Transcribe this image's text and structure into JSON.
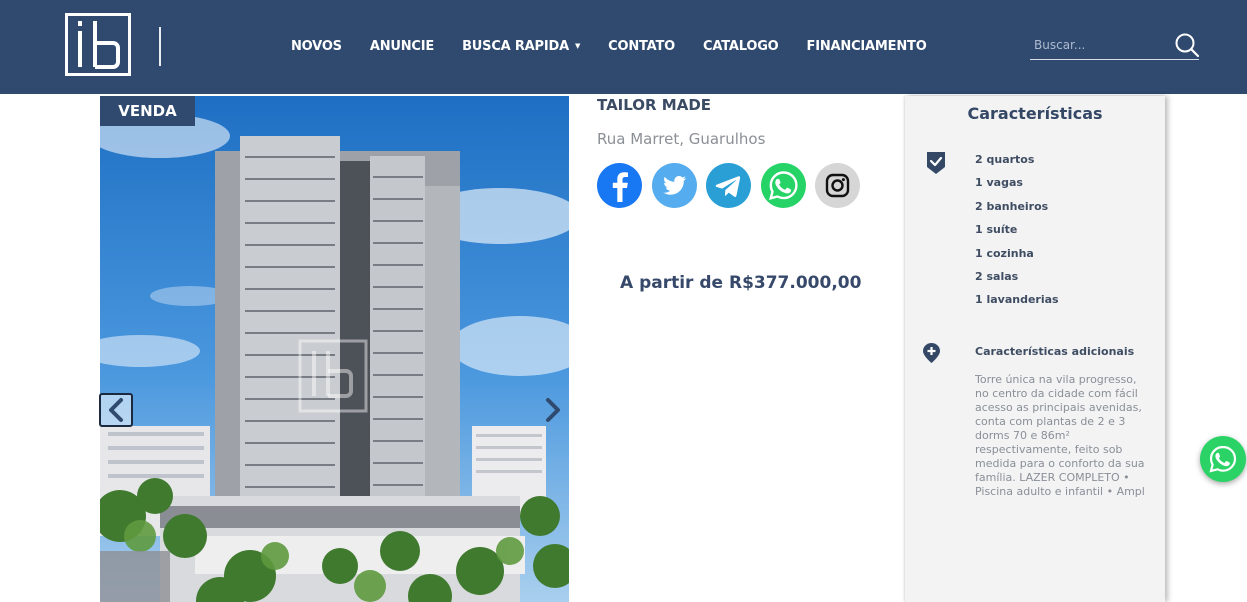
{
  "header": {
    "logo_text": "ib",
    "nav": [
      {
        "label": "NOVOS"
      },
      {
        "label": "ANUNCIE"
      },
      {
        "label": "BUSCA RAPIDA",
        "has_caret": true
      },
      {
        "label": "CONTATO"
      },
      {
        "label": "CATALOGO"
      },
      {
        "label": "FINANCIAMENTO"
      }
    ],
    "search_placeholder": "Buscar...",
    "search_icon": "search-icon"
  },
  "listing": {
    "badge": "VENDA",
    "title": "TAILOR MADE",
    "address": "Rua Marret, Guarulhos",
    "price": "A partir de R$377.000,00",
    "share": [
      {
        "name": "facebook-icon",
        "color": "#1877f2"
      },
      {
        "name": "twitter-icon",
        "color": "#55acee"
      },
      {
        "name": "telegram-icon",
        "color": "#2a9fd6"
      },
      {
        "name": "whatsapp-icon",
        "color": "#25d366"
      },
      {
        "name": "instagram-icon",
        "color": "#d6d6d6"
      }
    ],
    "watermark_text": "ib"
  },
  "characteristics": {
    "title": "Características",
    "features": [
      "2 quartos",
      "1 vagas",
      "2 banheiros",
      "1 suíte",
      "1 cozinha",
      "2 salas",
      "1 lavanderias"
    ],
    "extra_title": "Características adicionais",
    "extra_text": "Torre única na vila progresso, no centro da cidade com fácil acesso as principais avenidas, conta com plantas de 2 e 3 dorms 70 e 86m² respectivamente, feito sob medida para o conforto da sua família. LAZER COMPLETO • Piscina adulto e infantil • Ampl"
  },
  "colors": {
    "header_bg": "#2f4a6e",
    "accent": "#344866",
    "panel_bg": "#f3f3f4",
    "whatsapp": "#2bd366"
  }
}
